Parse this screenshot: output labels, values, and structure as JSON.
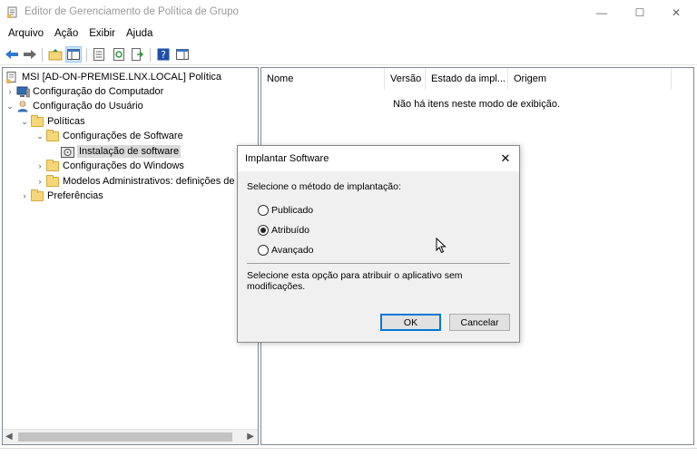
{
  "window": {
    "title": "Editor de Gerenciamento de Política de Grupo",
    "minimize_glyph": "—",
    "maximize_glyph": "☐",
    "close_glyph": "✕"
  },
  "menu": [
    "Arquivo",
    "Ação",
    "Exibir",
    "Ajuda"
  ],
  "toolbar": {
    "icons": [
      "back-arrow-icon",
      "forward-arrow-icon",
      "up-folder-icon",
      "show-hide-tree-icon",
      "properties-icon",
      "refresh-icon",
      "export-list-icon",
      "help-icon",
      "show-action-pane-icon"
    ]
  },
  "tree": {
    "root": "MSI [AD-ON-PREMISE.LNX.LOCAL] Política",
    "computer_config": "Configuração do Computador",
    "user_config": "Configuração do Usuário",
    "policies": "Políticas",
    "software_config": "Configurações de Software",
    "software_install": "Instalação de software",
    "windows_config": "Configurações do Windows",
    "admin_templates": "Modelos Administrativos: definições de",
    "preferences": "Preferências"
  },
  "list": {
    "columns": [
      "Nome",
      "Versão",
      "Estado da impl...",
      "Origem"
    ],
    "empty_message": "Não há itens neste modo de exibição."
  },
  "dialog": {
    "title": "Implantar Software",
    "prompt": "Selecione o método de implantação:",
    "options": [
      {
        "label": "Publicado",
        "checked": false
      },
      {
        "label": "Atribuído",
        "checked": true
      },
      {
        "label": "Avançado",
        "checked": false
      }
    ],
    "description": "Selecione esta opção para atribuir o aplicativo sem modificações.",
    "ok_label": "OK",
    "cancel_label": "Cancelar"
  },
  "colors": {
    "accent": "#0078d7",
    "folder": "#f5d77a",
    "selection": "#d9d9d9"
  }
}
